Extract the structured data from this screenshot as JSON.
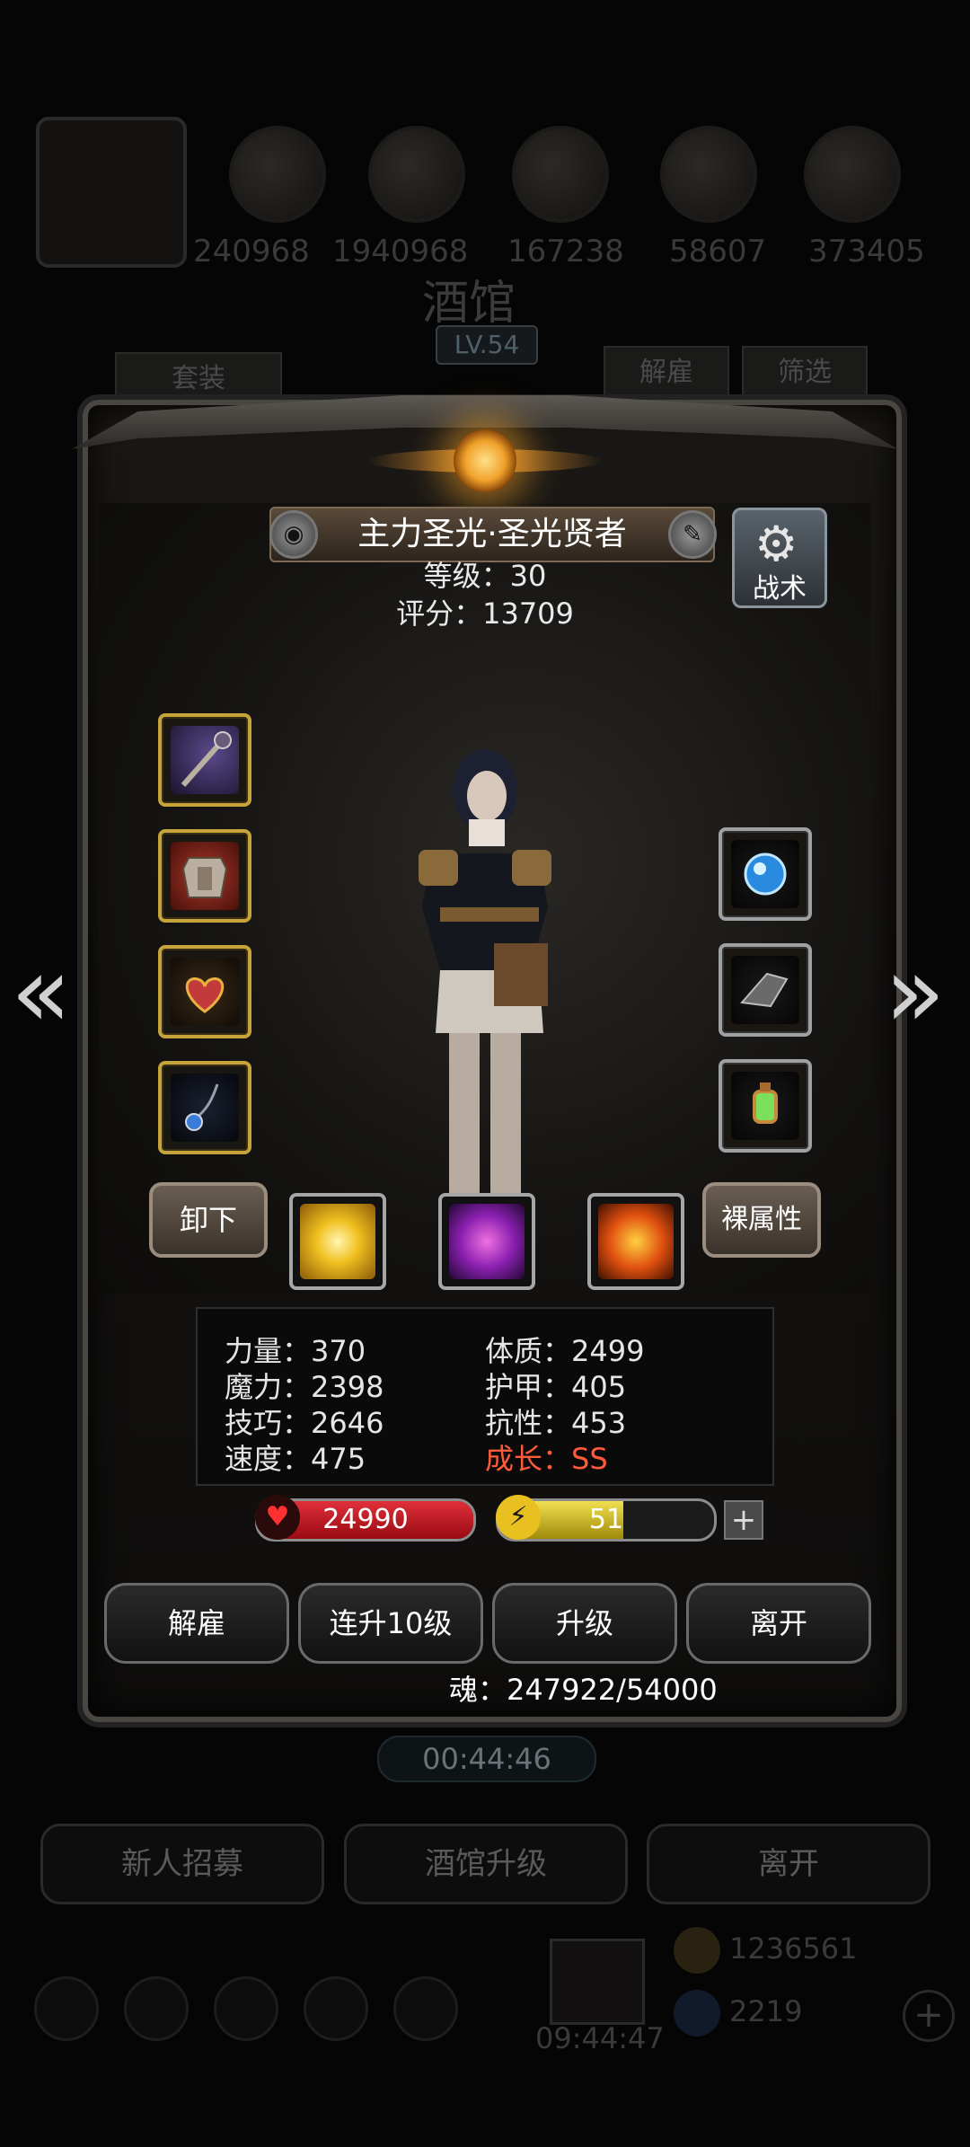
{
  "background": {
    "resource_values": [
      "240968",
      "1940968",
      "167238",
      "58607",
      "373405"
    ],
    "title": "酒馆",
    "level_badge": "LV.54",
    "set_button": "套装",
    "dismiss_button": "解雇",
    "filter_button": "筛选",
    "timer": "00:44:46",
    "recruit_button": "新人招募",
    "upgrade_tavern_button": "酒馆升级",
    "leave_button": "离开",
    "gold": "1236561",
    "gems": "2219",
    "clock": "09:44:47"
  },
  "hero": {
    "name": "主力圣光·圣光贤者",
    "level_line": "等级：30",
    "score_line": "评分：13709",
    "tactic_label": "战术",
    "unequip_button": "卸下",
    "raw_attr_button": "裸属性",
    "stats": {
      "strength": "力量：370",
      "magic": "魔力：2398",
      "skill": "技巧：2646",
      "speed": "速度：475",
      "constitution": "体质：2499",
      "armor": "护甲：405",
      "resistance": "抗性：453",
      "growth": "成长：SS"
    },
    "hp": "24990",
    "energy": "51",
    "energy_fraction": 0.58,
    "plus_symbol": "+",
    "soul_line": "魂：247922/54000"
  },
  "actions": {
    "dismiss": "解雇",
    "level_up_10": "连升10级",
    "level_up": "升级",
    "leave": "离开"
  },
  "icons": {
    "left_arrow": "«",
    "right_arrow": "»",
    "gear": "⚙",
    "edit": "✎",
    "badge": "◉",
    "heart": "♥",
    "bolt": "⚡"
  },
  "colors": {
    "growth": "#ff5a3a",
    "hp_fill": "#c4101a",
    "energy_fill": "#d8c21a",
    "gold_border": "#c7a43a"
  }
}
